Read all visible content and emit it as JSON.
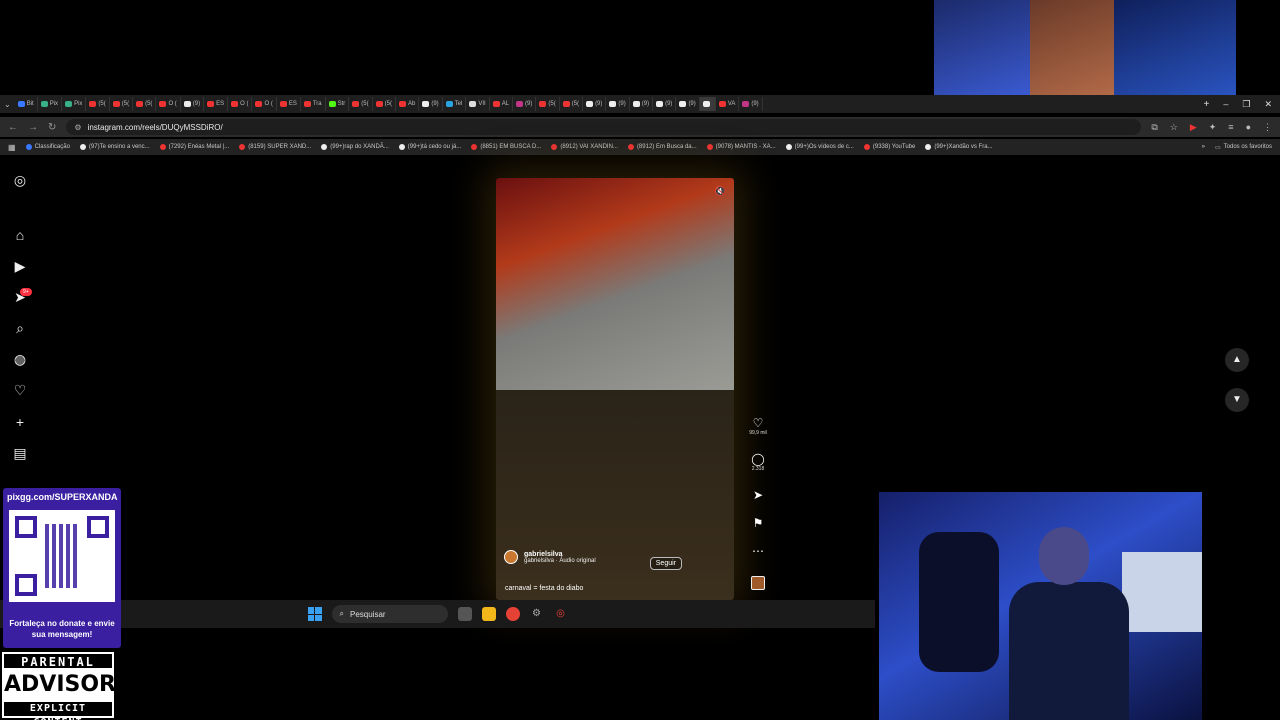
{
  "browser": {
    "tabs": [
      {
        "label": "Bit",
        "color": "#3a78ff"
      },
      {
        "label": "Pix",
        "color": "#3ab08a"
      },
      {
        "label": "Pix",
        "color": "#3ab08a"
      },
      {
        "label": "(5(",
        "color": "#e33"
      },
      {
        "label": "(5(",
        "color": "#e33"
      },
      {
        "label": "(5(",
        "color": "#e33"
      },
      {
        "label": "O (",
        "color": "#e33"
      },
      {
        "label": "(9)",
        "color": "#eee"
      },
      {
        "label": "ES",
        "color": "#e33"
      },
      {
        "label": "O (",
        "color": "#e33"
      },
      {
        "label": "O (",
        "color": "#e33"
      },
      {
        "label": "ES",
        "color": "#e33"
      },
      {
        "label": "Tra",
        "color": "#e33"
      },
      {
        "label": "Str",
        "color": "#53fc18"
      },
      {
        "label": "(5(",
        "color": "#e33"
      },
      {
        "label": "(5(",
        "color": "#e33"
      },
      {
        "label": "Ab",
        "color": "#e33"
      },
      {
        "label": "(9)",
        "color": "#eee"
      },
      {
        "label": "Tel",
        "color": "#2aa3e0"
      },
      {
        "label": "VII",
        "color": "#ddd"
      },
      {
        "label": "AL",
        "color": "#e33"
      },
      {
        "label": "(9)",
        "color": "#c13584"
      },
      {
        "label": "(5(",
        "color": "#e33"
      },
      {
        "label": "(5(",
        "color": "#e33"
      },
      {
        "label": "(9)",
        "color": "#eee"
      },
      {
        "label": "(9)",
        "color": "#eee"
      },
      {
        "label": "(9)",
        "color": "#eee"
      },
      {
        "label": "(9)",
        "color": "#eee"
      },
      {
        "label": "(9)",
        "color": "#eee"
      },
      {
        "label": "",
        "color": "#eee"
      },
      {
        "label": "VA",
        "color": "#e33"
      },
      {
        "label": "(9)",
        "color": "#c13584"
      }
    ],
    "active_tab_index": 29,
    "url": "instagram.com/reels/DUQyMSSDiRO/",
    "bookmarks": [
      {
        "label": "Classificação",
        "color": "#3a78ff"
      },
      {
        "label": "(97)Te ensino a venc...",
        "color": "#eee"
      },
      {
        "label": "(7292) Enéas Metal |...",
        "color": "#e33"
      },
      {
        "label": "(8159) SUPER XAND...",
        "color": "#e33"
      },
      {
        "label": "(99+)rap do XANDÃ...",
        "color": "#eee"
      },
      {
        "label": "(99+)tá cedo ou já...",
        "color": "#eee"
      },
      {
        "label": "(8851) EM BUSCA D...",
        "color": "#e33"
      },
      {
        "label": "(8912) VAI XANDIN...",
        "color": "#e33"
      },
      {
        "label": "(8912) Em Busca da...",
        "color": "#e33"
      },
      {
        "label": "(9078) MANTIS - XA...",
        "color": "#e33"
      },
      {
        "label": "(99+)Os vídeos de c...",
        "color": "#eee"
      },
      {
        "label": "(9338) YouTube",
        "color": "#e33"
      },
      {
        "label": "(99+)Xandão vs Fra...",
        "color": "#eee"
      }
    ],
    "all_favorites": "Todos os favoritos"
  },
  "instagram": {
    "notification_count": "9+",
    "reel": {
      "username": "gabrielsilva",
      "audio": "gabrielsilva · Áudio original",
      "follow_label": "Seguir",
      "caption": "carnaval = festa do diabo",
      "likes": "99,9 mil",
      "comments": "2.318"
    }
  },
  "taskbar": {
    "search_placeholder": "Pesquisar"
  },
  "overlay": {
    "donate_url": "pixgg.com/SUPERXANDA",
    "donate_message": "Fortaleça no donate e envie sua mensagem!",
    "advisory": {
      "line1": "PARENTAL",
      "line2": "ADVISORY",
      "line3": "EXPLICIT CONTENT"
    }
  },
  "colors": {
    "instagram_badge": "#ff3040",
    "donate_bg": "#3a1fa0"
  }
}
